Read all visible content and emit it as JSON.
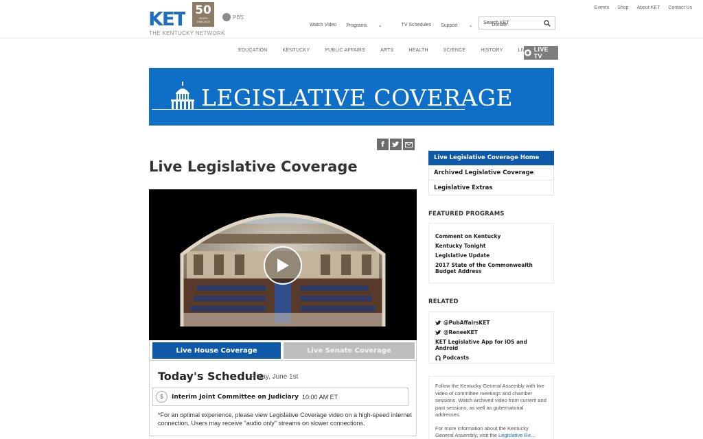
{
  "header": {
    "logo_text": "KET",
    "logo_sub": "THE KENTUCKY NETWORK",
    "anniversary": {
      "number": "50",
      "years": "YEARS",
      "range": "1968-2018"
    },
    "pbs": "PBS",
    "utility_links": [
      "Events",
      "Shop",
      "About KET",
      "Contact Us"
    ],
    "main_nav": [
      "Watch Video",
      "Programs",
      "TV Schedules",
      "Support",
      "Donate"
    ],
    "search_placeholder": "Search KET"
  },
  "category_nav": [
    "EDUCATION",
    "KENTUCKY",
    "PUBLIC AFFAIRS",
    "ARTS",
    "HEALTH",
    "SCIENCE",
    "HISTORY",
    "LIVING"
  ],
  "live_tv": "LIVE TV",
  "banner": {
    "title": "LEGISLATIVE COVERAGE"
  },
  "page_title": "Live Legislative Coverage",
  "tabs": {
    "house": "Live House Coverage",
    "senate": "Live Senate Coverage"
  },
  "schedule": {
    "heading": "Today's Schedule",
    "date": "Friday, June 1st",
    "item_icon": "$",
    "item_name": "Interim Joint Committee on Judiciary",
    "item_time": "10:00 AM ET",
    "note": "*For an optimal experience, please view Legislative Coverage video on a high-speed internet connection. Users may receive \"audio only\" streams on slower connections."
  },
  "sidebar": {
    "nav": [
      "Live Legislative Coverage Home",
      "Archived Legislative Coverage",
      "Legislative Extras"
    ],
    "featured_heading": "FEATURED PROGRAMS",
    "featured": [
      "Comment on Kentucky",
      "Kentucky Tonight",
      "Legislative Update",
      "2017 State of the Commonwealth Budget Address"
    ],
    "related_heading": "RELATED",
    "related": [
      {
        "label": "@PubAffairsKET",
        "icon": "twitter-icon"
      },
      {
        "label": "@ReneeKET",
        "icon": "twitter-icon"
      },
      {
        "label": "KET Legislative App for iOS and Android",
        "icon": ""
      },
      {
        "label": "Podcasts",
        "icon": "headphones-icon"
      }
    ],
    "about": "Follow the Kentucky General Assembly with live video of committee meetings and chamber sessions. Watch archived video from current and past sessions, as well as gubernatorial addresses.",
    "more_prefix": "For more information about the Kentucky General Assembly, visit the",
    "more_link": "Legislative Re..."
  },
  "colors": {
    "brand_blue": "#0f6fc6",
    "active_blue": "#0f5aa8",
    "gray_tab": "#bdbdbd"
  }
}
